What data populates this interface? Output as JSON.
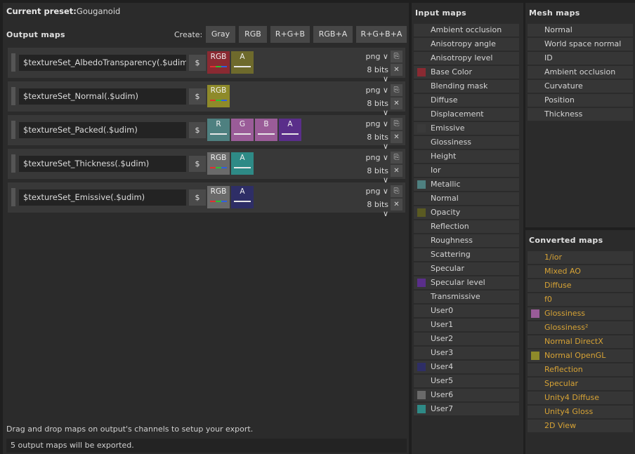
{
  "preset": {
    "label": "Current preset:",
    "name": "Gouganoid"
  },
  "output": {
    "title": "Output maps",
    "create_label": "Create:",
    "create_buttons": [
      "Gray",
      "RGB",
      "R+G+B",
      "RGB+A",
      "R+G+B+A"
    ],
    "rows": [
      {
        "name": "$textureSet_AlbedoTransparency(.$udim)",
        "format": "png",
        "bits": "8 bits",
        "channels": [
          {
            "label": "RGB",
            "color": "#8a2a32",
            "bar": "rgb"
          },
          {
            "label": "A",
            "color": "#6e6a2c",
            "bar": "line"
          }
        ]
      },
      {
        "name": "$textureSet_Normal(.$udim)",
        "format": "png",
        "bits": "8 bits",
        "channels": [
          {
            "label": "RGB",
            "color": "#8e8a2a",
            "bar": "rgb"
          }
        ]
      },
      {
        "name": "$textureSet_Packed(.$udim)",
        "format": "png",
        "bits": "8 bits",
        "channels": [
          {
            "label": "R",
            "color": "#4e8080",
            "bar": "line"
          },
          {
            "label": "G",
            "color": "#9a5c98",
            "bar": "line"
          },
          {
            "label": "B",
            "color": "#9a5c98",
            "bar": "line"
          },
          {
            "label": "A",
            "color": "#5a2e8a",
            "bar": "line"
          }
        ]
      },
      {
        "name": "$textureSet_Thickness(.$udim)",
        "format": "png",
        "bits": "8 bits",
        "channels": [
          {
            "label": "RGB",
            "color": "#6a6a6a",
            "bar": "rgb"
          },
          {
            "label": "A",
            "color": "#2e8a86",
            "bar": "line"
          }
        ]
      },
      {
        "name": "$textureSet_Emissive(.$udim)",
        "format": "png",
        "bits": "8 bits",
        "channels": [
          {
            "label": "RGB",
            "color": "#6a6a6a",
            "bar": "rgb"
          },
          {
            "label": "A",
            "color": "#2e2e66",
            "bar": "line"
          }
        ]
      }
    ],
    "dollar": "$",
    "hint": "Drag and drop maps on output's channels to setup your export.",
    "status": "5 output maps will be exported."
  },
  "input_maps": {
    "title": "Input maps",
    "items": [
      {
        "label": "Ambient occlusion"
      },
      {
        "label": "Anisotropy angle"
      },
      {
        "label": "Anisotropy level"
      },
      {
        "label": "Base Color",
        "color": "#8a2a32"
      },
      {
        "label": "Blending mask"
      },
      {
        "label": "Diffuse"
      },
      {
        "label": "Displacement"
      },
      {
        "label": "Emissive",
        "color": "#3a3a3a"
      },
      {
        "label": "Glossiness"
      },
      {
        "label": "Height"
      },
      {
        "label": "Ior"
      },
      {
        "label": "Metallic",
        "color": "#4e8080"
      },
      {
        "label": "Normal"
      },
      {
        "label": "Opacity",
        "color": "#5a5a22"
      },
      {
        "label": "Reflection"
      },
      {
        "label": "Roughness"
      },
      {
        "label": "Scattering"
      },
      {
        "label": "Specular"
      },
      {
        "label": "Specular level",
        "color": "#5a2e8a"
      },
      {
        "label": "Transmissive"
      },
      {
        "label": "User0"
      },
      {
        "label": "User1"
      },
      {
        "label": "User2"
      },
      {
        "label": "User3"
      },
      {
        "label": "User4",
        "color": "#2e2e66"
      },
      {
        "label": "User5"
      },
      {
        "label": "User6",
        "color": "#6a6a6a"
      },
      {
        "label": "User7",
        "color": "#2e8a86"
      }
    ]
  },
  "mesh_maps": {
    "title": "Mesh maps",
    "items": [
      {
        "label": "Normal"
      },
      {
        "label": "World space normal"
      },
      {
        "label": "ID"
      },
      {
        "label": "Ambient occlusion"
      },
      {
        "label": "Curvature"
      },
      {
        "label": "Position"
      },
      {
        "label": "Thickness"
      }
    ]
  },
  "converted_maps": {
    "title": "Converted maps",
    "items": [
      {
        "label": "1/ior"
      },
      {
        "label": "Mixed AO"
      },
      {
        "label": "Diffuse"
      },
      {
        "label": "f0"
      },
      {
        "label": "Glossiness",
        "color": "#9a5c98"
      },
      {
        "label": "Glossiness²"
      },
      {
        "label": "Normal DirectX"
      },
      {
        "label": "Normal OpenGL",
        "color": "#8e8a2a"
      },
      {
        "label": "Reflection"
      },
      {
        "label": "Specular"
      },
      {
        "label": "Unity4 Diffuse"
      },
      {
        "label": "Unity4 Gloss"
      },
      {
        "label": "2D View"
      }
    ]
  }
}
